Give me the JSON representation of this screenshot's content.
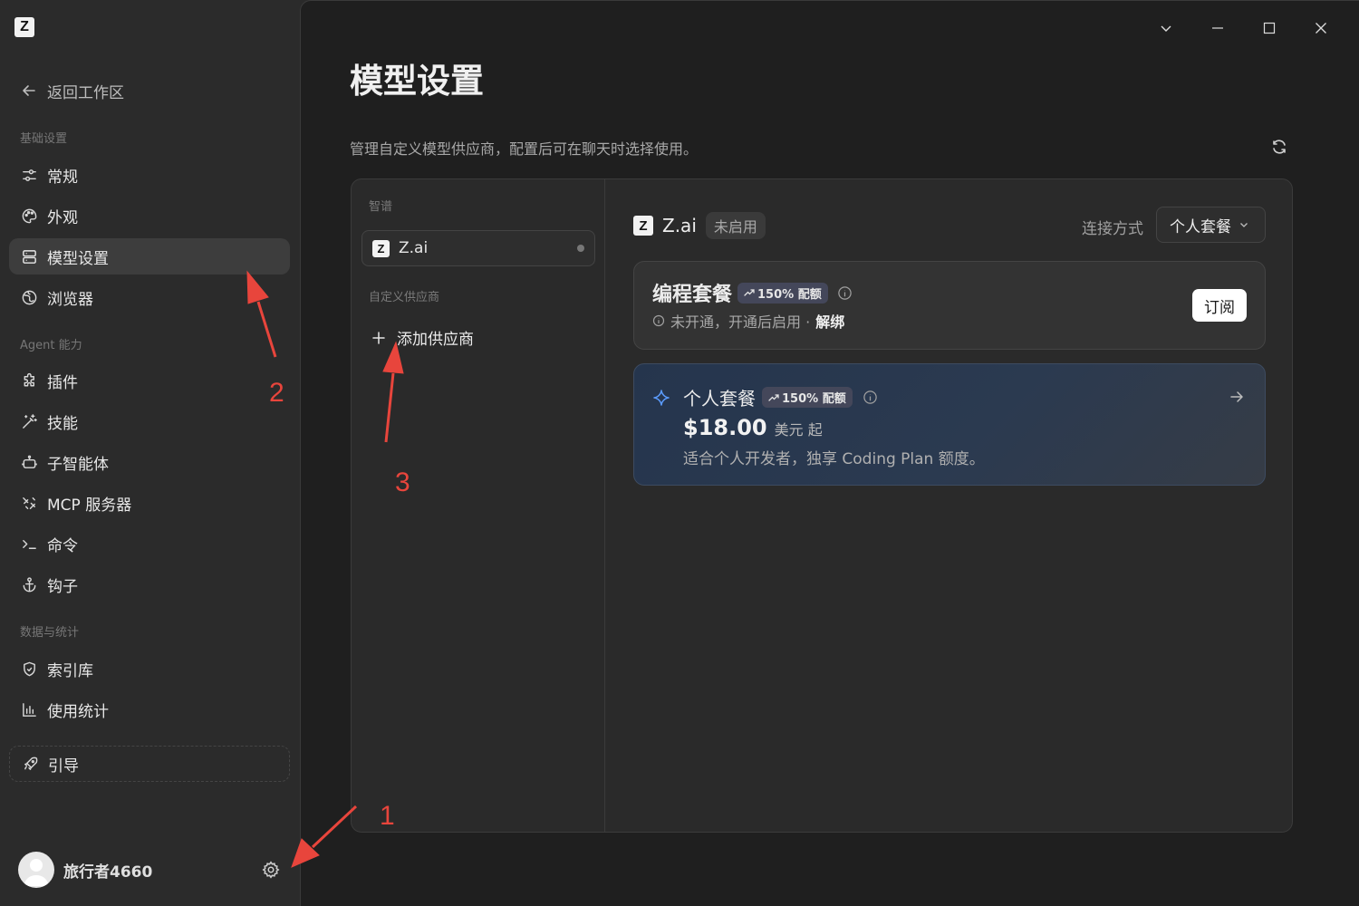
{
  "sidebar": {
    "back_label": "返回工作区",
    "sections": {
      "basic": "基础设置",
      "agent": "Agent 能力",
      "data": "数据与统计"
    },
    "items": {
      "general": "常规",
      "appearance": "外观",
      "model_settings": "模型设置",
      "browser": "浏览器",
      "plugins": "插件",
      "skills": "技能",
      "sub_agents": "子智能体",
      "mcp": "MCP 服务器",
      "commands": "命令",
      "hooks": "钩子",
      "index": "索引库",
      "usage": "使用统计"
    },
    "guide_label": "引导",
    "username": "旅行者4660"
  },
  "main": {
    "title": "模型设置",
    "description": "管理自定义模型供应商，配置后可在聊天时选择使用。",
    "left_panel": {
      "group_label": "智谱",
      "provider_name": "Z.ai",
      "custom_label": "自定义供应商",
      "add_label": "添加供应商"
    },
    "right_panel": {
      "provider_title": "Z.ai",
      "status_badge": "未启用",
      "connection_label": "连接方式",
      "connection_value": "个人套餐",
      "coding_plan": {
        "title": "编程套餐",
        "quota_badge": "150% 配额",
        "status_text": "未开通，开通后启用 ·",
        "unbind_label": "解绑",
        "subscribe_label": "订阅"
      },
      "personal_plan": {
        "title": "个人套餐",
        "quota_badge": "150% 配额",
        "price": "$18.00",
        "price_unit": "美元 起",
        "description": "适合个人开发者，独享 Coding Plan 额度。"
      }
    }
  },
  "annotations": [
    "1",
    "2",
    "3"
  ],
  "colors": {
    "annotation_red": "#e8453c",
    "active_nav": "#3d3d3d",
    "accent_blue": "#5b9cff"
  }
}
